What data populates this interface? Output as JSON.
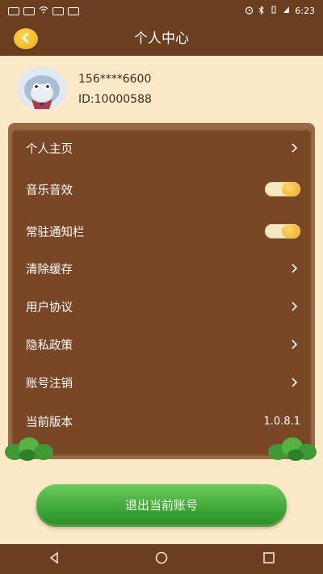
{
  "status": {
    "time": "6:23"
  },
  "nav": {
    "title": "个人中心"
  },
  "profile": {
    "phone": "156****6600",
    "user_id": "ID:10000588"
  },
  "settings": {
    "items": [
      {
        "label": "个人主页",
        "control": "chevron-right-icon"
      },
      {
        "label": "音乐音效",
        "control": "toggle",
        "on": true
      },
      {
        "label": "常驻通知栏",
        "control": "toggle",
        "on": true
      },
      {
        "label": "清除缓存",
        "control": "chevron-right-icon"
      },
      {
        "label": "用户协议",
        "control": "chevron-right-icon"
      },
      {
        "label": "隐私政策",
        "control": "chevron-right-icon"
      },
      {
        "label": "账号注销",
        "control": "chevron-right-icon"
      },
      {
        "label": "当前版本",
        "value": "1.0.8.1"
      }
    ]
  },
  "logout": {
    "label": "退出当前账号"
  },
  "colors": {
    "background": "#fbe9c8",
    "header": "#6b3e1f",
    "panel": "#7a4726",
    "toggle_knob": "#f2a81a",
    "logout_button": "#3ea838"
  }
}
